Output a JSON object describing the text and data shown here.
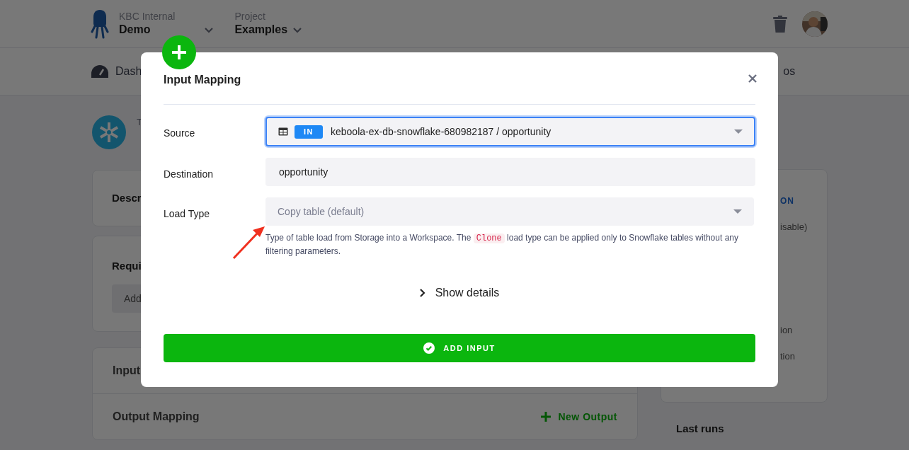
{
  "header": {
    "organization": {
      "label": "KBC Internal",
      "name": "Demo"
    },
    "project": {
      "label": "Project",
      "name": "Examples"
    }
  },
  "nav": {
    "items": [
      "Dash",
      "os"
    ]
  },
  "component": {
    "type_fragment": "T"
  },
  "cards": {
    "description": "Descr",
    "required": {
      "title": "Requi",
      "button": "Add"
    },
    "input_mapping": "Input",
    "output_mapping": {
      "title": "Output Mapping",
      "button": "New Output"
    }
  },
  "sidebar": {
    "sections": [
      {
        "heading": "ON",
        "lines": [
          "isable)"
        ]
      },
      {
        "lines": [
          "ion",
          "tion"
        ]
      }
    ]
  },
  "last_runs": {
    "title": "Last runs"
  },
  "modal": {
    "title": "Input Mapping",
    "fields": [
      {
        "label": "Source",
        "kind": "table-select",
        "badge": "IN",
        "value": "keboola-ex-db-snowflake-680982187 / opportunity",
        "focused": true
      },
      {
        "label": "Destination",
        "kind": "text",
        "value": "opportunity",
        "focused": false
      },
      {
        "label": "Load Type",
        "kind": "select",
        "placeholder": "Copy table (default)",
        "focused": false,
        "help_before": "Type of table load from Storage into a Workspace. The",
        "help_code": "Clone",
        "help_after": "load type can be applied only to Snowflake tables without any filtering parameters."
      }
    ],
    "details_toggle": {
      "label": "Show details",
      "expanded": false
    },
    "submit": "ADD INPUT"
  }
}
